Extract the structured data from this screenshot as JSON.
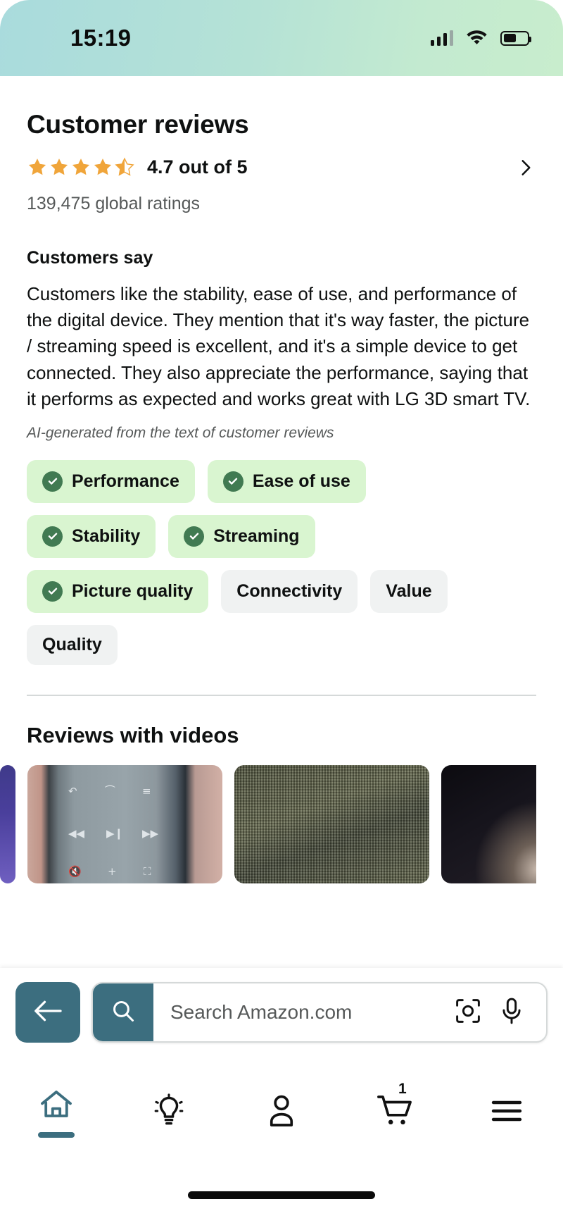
{
  "status_bar": {
    "time": "15:19",
    "signal_icon": "cellular-signal-icon",
    "wifi_icon": "wifi-icon",
    "battery_icon": "battery-icon"
  },
  "reviews": {
    "page_title": "Customer reviews",
    "rating_text": "4.7 out of 5",
    "rating_value": 4.7,
    "rating_max": 5,
    "stars_filled": 4,
    "has_half_star": true,
    "global_ratings": "139,475 global ratings",
    "chevron_icon": "chevron-right-icon",
    "star_color": "#f0a53a"
  },
  "customers_say": {
    "heading": "Customers say",
    "summary": "Customers like the stability, ease of use, and performance of the digital device. They mention that it's way faster, the picture / streaming speed is excellent, and it's a simple device to get connected. They also appreciate the performance, saying that it performs as expected and works great with LG 3D smart TV.",
    "ai_note": "AI-generated from the text of customer reviews"
  },
  "topic_chips": [
    {
      "label": "Performance",
      "positive": true
    },
    {
      "label": "Ease of use",
      "positive": true
    },
    {
      "label": "Stability",
      "positive": true
    },
    {
      "label": "Streaming",
      "positive": true
    },
    {
      "label": "Picture quality",
      "positive": true
    },
    {
      "label": "Connectivity",
      "positive": false
    },
    {
      "label": "Value",
      "positive": false
    },
    {
      "label": "Quality",
      "positive": false
    }
  ],
  "videos_section": {
    "title": "Reviews with videos",
    "thumbnails": [
      {
        "kind": "violet",
        "name": "review-video-thumbnail-partial-left"
      },
      {
        "kind": "remote",
        "name": "review-video-thumbnail-remote-control"
      },
      {
        "kind": "fabric",
        "name": "review-video-thumbnail-fabric-couch"
      },
      {
        "kind": "dark",
        "name": "review-video-thumbnail-dark-scene"
      }
    ]
  },
  "search_dock": {
    "back_icon": "arrow-left-icon",
    "search_icon": "search-icon",
    "placeholder": "Search Amazon.com",
    "value": "",
    "camera_icon": "camera-lens-icon",
    "mic_icon": "microphone-icon",
    "accent_color": "#3c6e7f"
  },
  "bottom_nav": {
    "active_index": 0,
    "items": [
      {
        "name": "nav-home",
        "icon": "home-icon",
        "active": true,
        "badge": ""
      },
      {
        "name": "nav-ideas",
        "icon": "lightbulb-icon",
        "active": false,
        "badge": ""
      },
      {
        "name": "nav-account",
        "icon": "person-icon",
        "active": false,
        "badge": ""
      },
      {
        "name": "nav-cart",
        "icon": "shopping-cart-icon",
        "active": false,
        "badge": "1"
      },
      {
        "name": "nav-menu",
        "icon": "hamburger-menu-icon",
        "active": false,
        "badge": ""
      }
    ]
  }
}
